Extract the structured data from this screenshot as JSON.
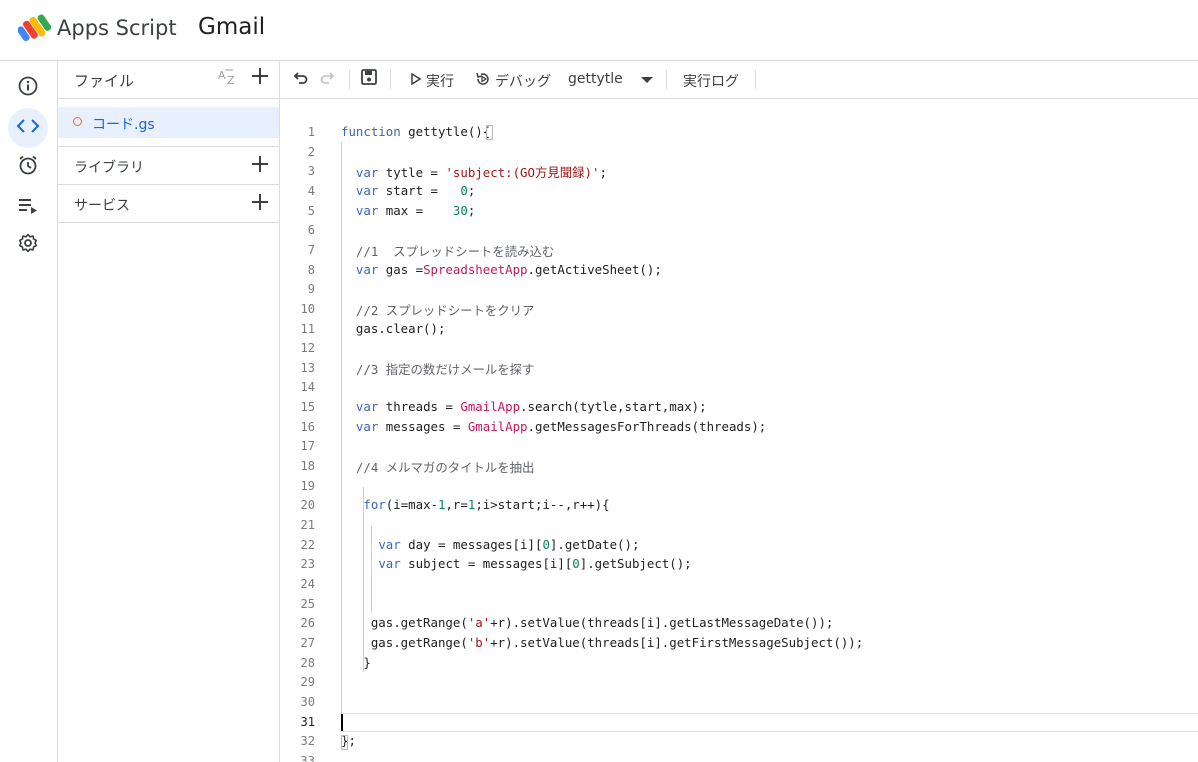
{
  "header": {
    "app_name": "Apps Script",
    "project_name": "Gmail"
  },
  "rail": {
    "items": [
      {
        "icon": "info-icon"
      },
      {
        "icon": "code-icon"
      },
      {
        "icon": "alarm-clock-icon"
      },
      {
        "icon": "executions-icon"
      },
      {
        "icon": "settings-gear-icon"
      }
    ]
  },
  "files": {
    "title": "ファイル",
    "items": [
      {
        "name": "コード.gs"
      }
    ],
    "sections": [
      {
        "label": "ライブラリ"
      },
      {
        "label": "サービス"
      }
    ]
  },
  "toolbar": {
    "run_label": "実行",
    "debug_label": "デバッグ",
    "function_name": "gettytle",
    "log_label": "実行ログ"
  },
  "editor": {
    "current_line": 31,
    "lines": [
      "function gettytle(){",
      "",
      "  var tytle = 'subject:(GO方見聞録)';",
      "  var start =   0;",
      "  var max =    30;",
      "",
      "  //1  スプレッドシートを読み込む",
      "  var gas =SpreadsheetApp.getActiveSheet();",
      "",
      "  //2 スプレッドシートをクリア",
      "  gas.clear();",
      "",
      "  //3 指定の数だけメールを探す",
      "",
      "  var threads = GmailApp.search(tytle,start,max);",
      "  var messages = GmailApp.getMessagesForThreads(threads);",
      "",
      "  //4 メルマガのタイトルを抽出",
      "",
      "   for(i=max-1,r=1;i>start;i--,r++){",
      "",
      "     var day = messages[i][0].getDate();",
      "     var subject = messages[i][0].getSubject();",
      "",
      "",
      "    gas.getRange('a'+r).setValue(threads[i].getLastMessageDate());",
      "    gas.getRange('b'+r).setValue(threads[i].getFirstMessageSubject());",
      "   }",
      "",
      "",
      "",
      "};",
      ""
    ]
  }
}
